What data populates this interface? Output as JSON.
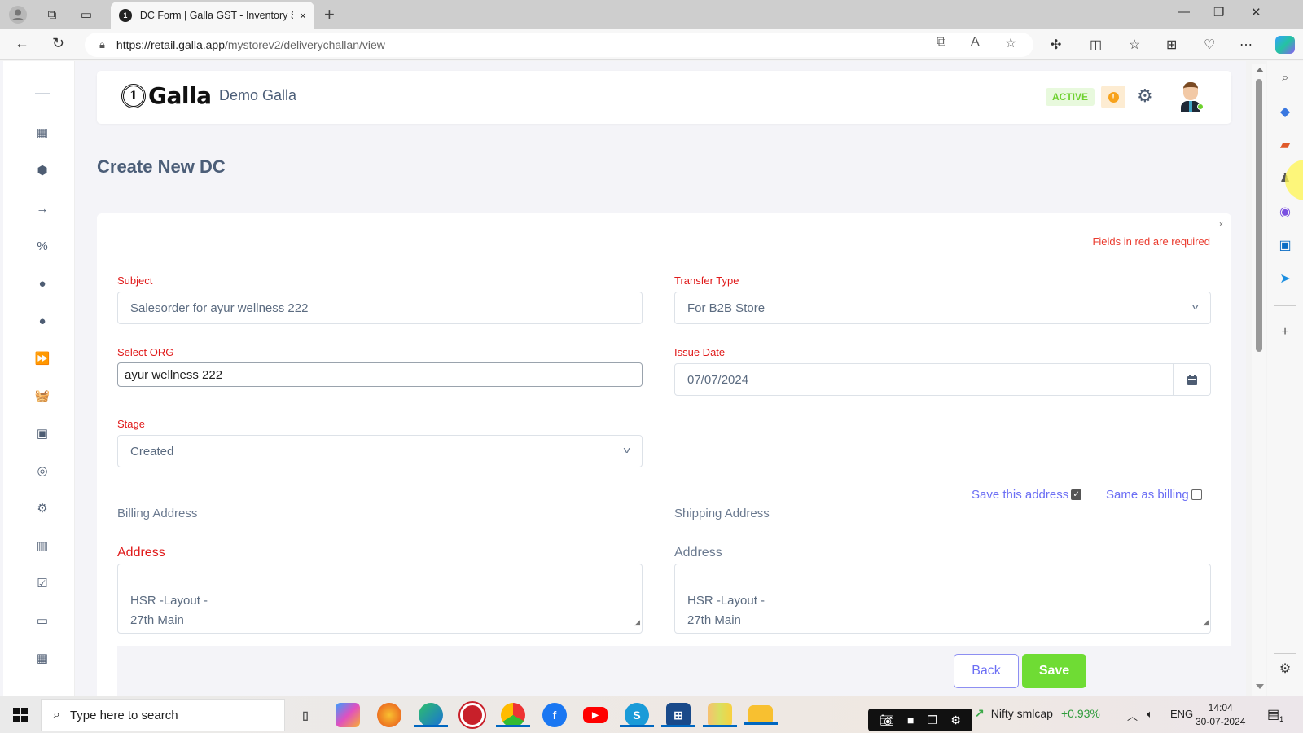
{
  "browser": {
    "tab_title": "DC Form | Galla GST - Inventory S",
    "url_host": "https://retail.galla.app",
    "url_path": "/mystorev2/deliverychallan/view",
    "new_tab_label": "+",
    "tab_close_label": "×"
  },
  "header": {
    "logo_text": "Galla",
    "logo_badge": "1",
    "store_name": "Demo Galla",
    "status_badge": "ACTIVE",
    "warning_badge": "!"
  },
  "page": {
    "title": "Create New DC"
  },
  "form": {
    "required_note": "Fields in red are required",
    "close_label": "x",
    "subject": {
      "label": "Subject",
      "value": "Salesorder for ayur wellness 222"
    },
    "transfer_type": {
      "label": "Transfer Type",
      "value": "For B2B Store"
    },
    "select_org": {
      "label": "Select ORG",
      "value": "ayur wellness 222"
    },
    "issue_date": {
      "label": "Issue Date",
      "value": "07/07/2024"
    },
    "stage": {
      "label": "Stage",
      "value": "Created"
    },
    "save_address": {
      "label": "Save this address",
      "checked": true
    },
    "same_as_billing": {
      "label": "Same as billing",
      "checked": false
    },
    "billing": {
      "section_label": "Billing Address",
      "address_label": "Address",
      "address_value": "HSR -Layout -\n27th Main"
    },
    "shipping": {
      "section_label": "Shipping Address",
      "address_label": "Address",
      "address_value": "HSR -Layout -\n27th Main"
    },
    "back_label": "Back",
    "save_label": "Save"
  },
  "sidebar": {
    "items": [
      {
        "name": "dashboard",
        "icon": "▦"
      },
      {
        "name": "products",
        "icon": "⬢"
      },
      {
        "name": "transfer",
        "icon": "→"
      },
      {
        "name": "discounts",
        "icon": "%"
      },
      {
        "name": "customers",
        "icon": "●"
      },
      {
        "name": "vendors",
        "icon": "●"
      },
      {
        "name": "fast-forward",
        "icon": "⏩"
      },
      {
        "name": "orders",
        "icon": "🧺"
      },
      {
        "name": "contacts",
        "icon": "▣"
      },
      {
        "name": "locations",
        "icon": "◎"
      },
      {
        "name": "settings",
        "icon": "⚙"
      },
      {
        "name": "reports",
        "icon": "▥"
      },
      {
        "name": "tasks",
        "icon": "☑"
      },
      {
        "name": "payments",
        "icon": "▭"
      },
      {
        "name": "calendar",
        "icon": "▦"
      }
    ]
  },
  "taskbar": {
    "search_placeholder": "Type here to search",
    "ticker_name": "Nifty smlcap",
    "ticker_change": "+0.93%",
    "language": "ENG",
    "time": "14:04",
    "date": "30-07-2024",
    "notification_count": "1"
  },
  "colors": {
    "required_red": "#e01a1a",
    "accent_purple": "#6b6ef4",
    "save_green": "#6fdc34",
    "active_green": "#6ed12e",
    "heading_slate": "#4c5e78"
  }
}
